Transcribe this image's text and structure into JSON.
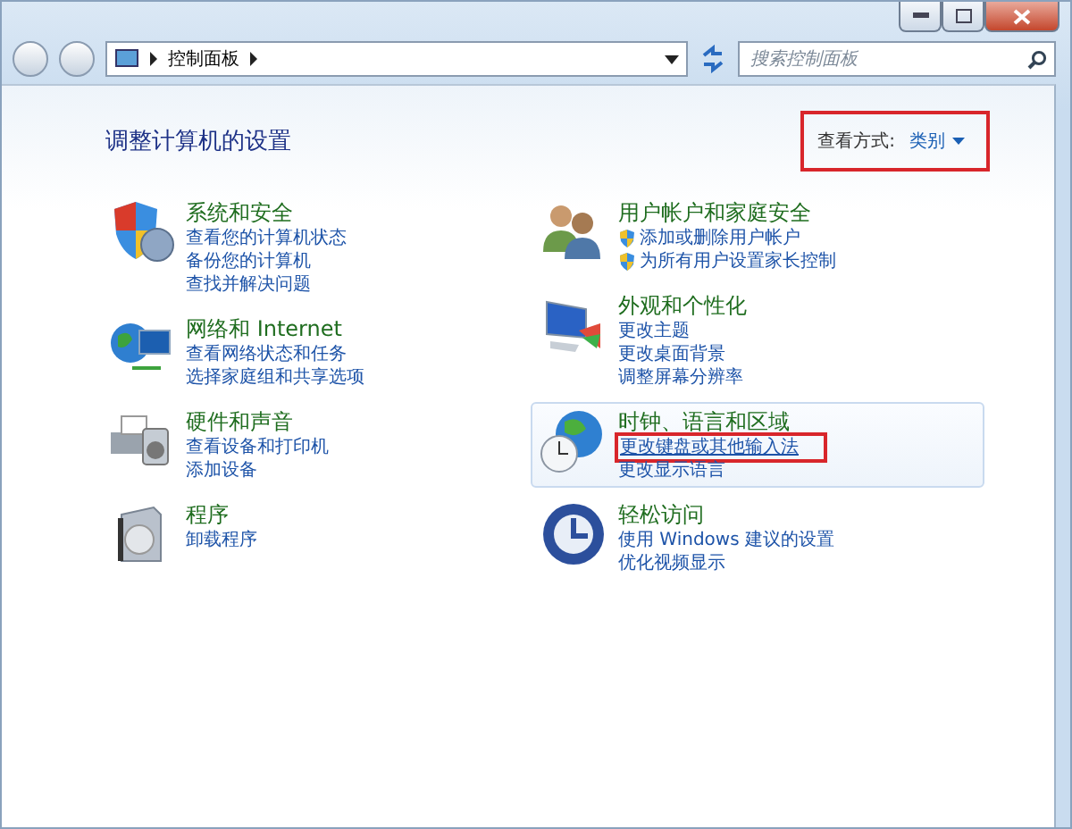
{
  "address_bar": {
    "breadcrumb": "控制面板"
  },
  "search": {
    "placeholder": "搜索控制面板"
  },
  "heading": "调整计算机的设置",
  "view_by": {
    "label": "查看方式:",
    "value": "类别",
    "highlighted": true
  },
  "columns": [
    [
      {
        "kind": "security",
        "title": "系统和安全",
        "hovered": false,
        "links": [
          {
            "text": "查看您的计算机状态",
            "shield": false,
            "highlighted": false
          },
          {
            "text": "备份您的计算机",
            "shield": false,
            "highlighted": false
          },
          {
            "text": "查找并解决问题",
            "shield": false,
            "highlighted": false
          }
        ]
      },
      {
        "kind": "network",
        "title": "网络和 Internet",
        "hovered": false,
        "links": [
          {
            "text": "查看网络状态和任务",
            "shield": false,
            "highlighted": false
          },
          {
            "text": "选择家庭组和共享选项",
            "shield": false,
            "highlighted": false
          }
        ]
      },
      {
        "kind": "hardware",
        "title": "硬件和声音",
        "hovered": false,
        "links": [
          {
            "text": "查看设备和打印机",
            "shield": false,
            "highlighted": false
          },
          {
            "text": "添加设备",
            "shield": false,
            "highlighted": false
          }
        ]
      },
      {
        "kind": "programs",
        "title": "程序",
        "hovered": false,
        "links": [
          {
            "text": "卸载程序",
            "shield": false,
            "highlighted": false
          }
        ]
      }
    ],
    [
      {
        "kind": "users",
        "title": "用户帐户和家庭安全",
        "hovered": false,
        "links": [
          {
            "text": "添加或删除用户帐户",
            "shield": true,
            "highlighted": false
          },
          {
            "text": "为所有用户设置家长控制",
            "shield": true,
            "highlighted": false
          }
        ]
      },
      {
        "kind": "appearance",
        "title": "外观和个性化",
        "hovered": false,
        "links": [
          {
            "text": "更改主题",
            "shield": false,
            "highlighted": false
          },
          {
            "text": "更改桌面背景",
            "shield": false,
            "highlighted": false
          },
          {
            "text": "调整屏幕分辨率",
            "shield": false,
            "highlighted": false
          }
        ]
      },
      {
        "kind": "clock",
        "title": "时钟、语言和区域",
        "hovered": true,
        "links": [
          {
            "text": "更改键盘或其他输入法",
            "shield": false,
            "highlighted": true
          },
          {
            "text": "更改显示语言",
            "shield": false,
            "highlighted": false
          }
        ]
      },
      {
        "kind": "access",
        "title": "轻松访问",
        "hovered": false,
        "links": [
          {
            "text": "使用 Windows 建议的设置",
            "shield": false,
            "highlighted": false
          },
          {
            "text": "优化视频显示",
            "shield": false,
            "highlighted": false
          }
        ]
      }
    ]
  ]
}
